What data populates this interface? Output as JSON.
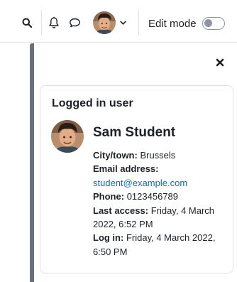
{
  "navbar": {
    "search_icon": "search-icon",
    "notifications_icon": "bell-icon",
    "messages_icon": "chat-bubble-icon",
    "user_menu_icon": "chevron-down-icon",
    "edit_mode_label": "Edit mode",
    "edit_mode_on": false
  },
  "drawer": {
    "close_icon": "close-icon",
    "block_title": "Logged in user",
    "user": {
      "name": "Sam Student",
      "city_label": "City/town:",
      "city_value": "Brussels",
      "email_label": "Email address:",
      "email_value": "student@example.com",
      "phone_label": "Phone:",
      "phone_value": "0123456789",
      "last_access_label": "Last access:",
      "last_access_value": "Friday, 4 March 2022, 6:52 PM",
      "login_label": "Log in:",
      "login_value": "Friday, 4 March 2022, 6:50 PM"
    }
  },
  "colors": {
    "link": "#0f6cbf",
    "text": "#1d2125",
    "border": "#dee2e6",
    "drawer_handle": "#6a737b"
  }
}
